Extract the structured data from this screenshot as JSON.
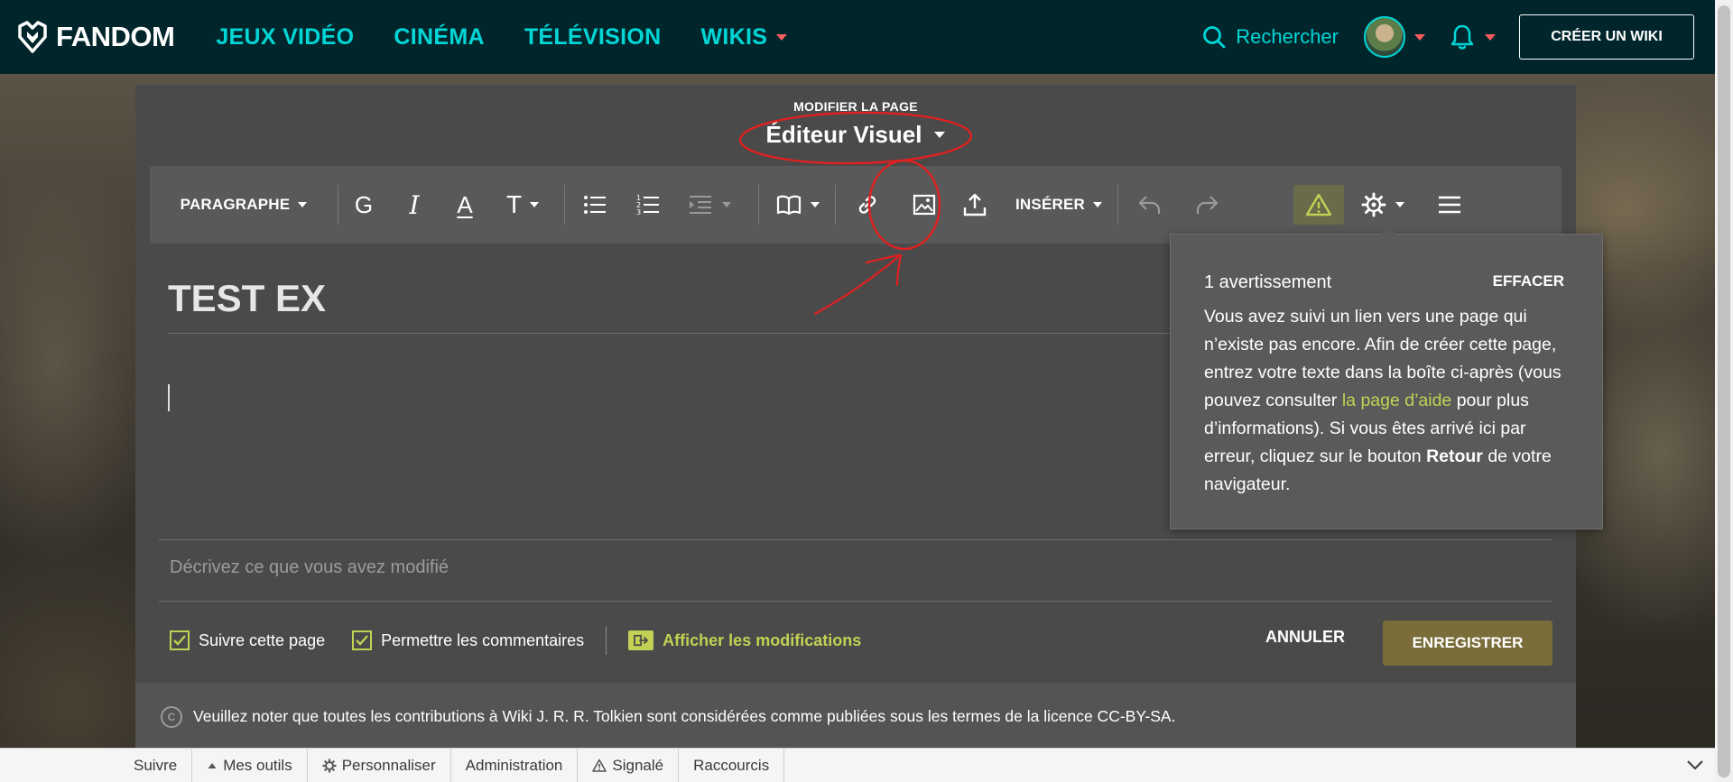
{
  "topnav": {
    "brand": "FANDOM",
    "links": [
      "JEUX VIDÉO",
      "CINÉMA",
      "TÉLÉVISION",
      "WIKIS"
    ],
    "search_label": "Rechercher",
    "create_wiki": "CRÉER UN WIKI"
  },
  "editor": {
    "header": "MODIFIER LA PAGE",
    "mode": "Éditeur Visuel",
    "toolbar": {
      "paragraph": "PARAGRAPHE",
      "bold": "G",
      "italic": "I",
      "text_color": "A",
      "text_style": "T",
      "insert": "INSÉRER"
    },
    "page_title": "TEST EX",
    "summary_placeholder": "Décrivez ce que vous avez modifié",
    "watch_label": "Suivre cette page",
    "comments_label": "Permettre les commentaires",
    "show_changes": "Afficher les modifications",
    "cancel": "ANNULER",
    "save": "ENREGISTRER",
    "license": "Veuillez noter que toutes les contributions à Wiki J. R. R. Tolkien sont considérées comme publiées sous les termes de la licence CC-BY-SA."
  },
  "warning": {
    "count": "1 avertissement",
    "clear": "EFFACER",
    "msg_part1": "Vous avez suivi un lien vers une page qui n’existe pas encore. Afin de créer cette page, entrez votre texte dans la boîte ci-après (vous pouvez consulter ",
    "msg_link": "la page d’aide",
    "msg_part2": " pour plus d’informations). Si vous êtes arrivé ici par erreur, cliquez sur le bouton ",
    "msg_bold": "Retour",
    "msg_part3": " de votre navigateur."
  },
  "bottombar": {
    "items": [
      "Suivre",
      "Mes outils",
      "Personnaliser",
      "Administration",
      "Signalé",
      "Raccourcis"
    ]
  },
  "colors": {
    "nav_bg": "#00262c",
    "nav_accent": "#00d6d6",
    "caret_accent": "#fa5c60",
    "panel_bg": "#4a4a4a",
    "link_accent": "#c2d153",
    "save_bg": "#7a6d3a",
    "annotation": "#e02020"
  }
}
